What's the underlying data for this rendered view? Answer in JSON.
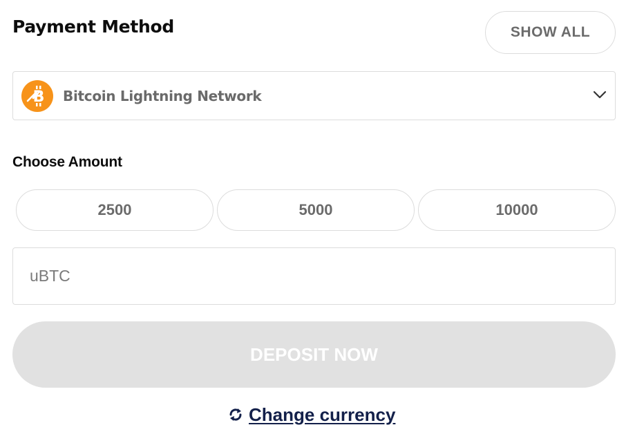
{
  "payment": {
    "title": "Payment Method",
    "show_all_label": "SHOW ALL",
    "selected_method": "Bitcoin Lightning Network",
    "method_icon": "bitcoin-lightning-icon",
    "accent_color": "#f7931a"
  },
  "amount": {
    "title": "Choose Amount",
    "presets": [
      "2500",
      "5000",
      "10000"
    ],
    "input_value": "",
    "input_placeholder": "uBTC"
  },
  "actions": {
    "deposit_label": "DEPOSIT NOW",
    "deposit_state": "disabled",
    "change_currency_label": "Change currency",
    "change_currency_icon": "swap-arrows-icon"
  }
}
